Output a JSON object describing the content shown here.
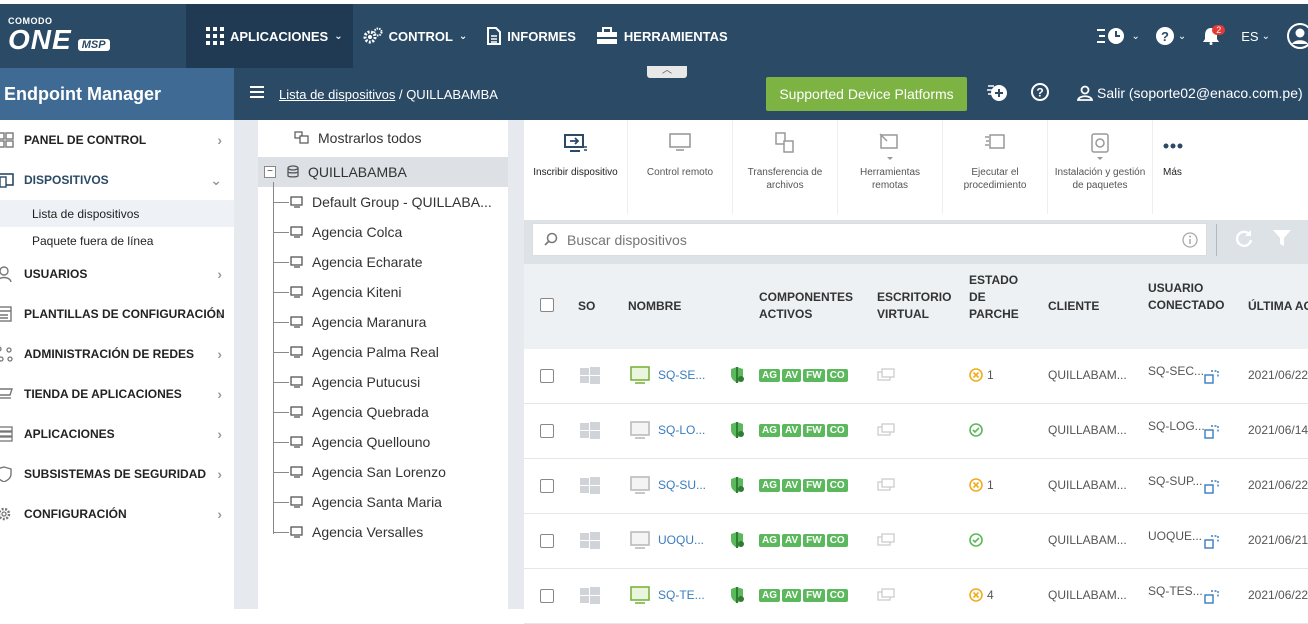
{
  "brand": {
    "company": "COMODO",
    "product": "ONE",
    "edition": "MSP"
  },
  "topnav": {
    "menus": [
      {
        "label": "APLICACIONES",
        "active": true,
        "dropdown": true,
        "icon": "grid-icon"
      },
      {
        "label": "CONTROL",
        "active": false,
        "dropdown": true,
        "icon": "gears-icon"
      },
      {
        "label": "INFORMES",
        "active": false,
        "dropdown": false,
        "icon": "report-icon"
      },
      {
        "label": "HERRAMIENTAS",
        "active": false,
        "dropdown": false,
        "icon": "toolbox-icon"
      }
    ],
    "notifications_count": "2",
    "language": "ES"
  },
  "module_title": "Endpoint Manager",
  "breadcrumb": {
    "link": "Lista de dispositivos",
    "separator": " / ",
    "current": "QUILLABAMBA"
  },
  "supported_button": "Supported Device Platforms",
  "logout": "Salir (soporte02@enaco.com.pe)",
  "sidebar": {
    "items": [
      {
        "label": "PANEL DE CONTROL",
        "icon": "dashboard-icon"
      },
      {
        "label": "DISPOSITIVOS",
        "icon": "devices-icon",
        "expanded": true
      },
      {
        "label": "USUARIOS",
        "icon": "user-icon"
      },
      {
        "label": "PLANTILLAS DE CONFIGURACIÓN",
        "icon": "template-icon"
      },
      {
        "label": "ADMINISTRACIÓN DE REDES",
        "icon": "network-icon"
      },
      {
        "label": "TIENDA DE APLICACIONES",
        "icon": "store-icon"
      },
      {
        "label": "APLICACIONES",
        "icon": "apps-icon"
      },
      {
        "label": "SUBSISTEMAS DE SEGURIDAD",
        "icon": "shield-icon"
      },
      {
        "label": "CONFIGURACIÓN",
        "icon": "gear-icon"
      }
    ],
    "sub_items": [
      "Lista de dispositivos",
      "Paquete fuera de línea"
    ]
  },
  "tree": {
    "show_all": "Mostrarlos todos",
    "root": "QUILLABAMBA",
    "children": [
      "Default Group - QUILLABA...",
      "Agencia Colca",
      "Agencia Echarate",
      "Agencia Kiteni",
      "Agencia Maranura",
      "Agencia Palma Real",
      "Agencia Putucusi",
      "Agencia Quebrada",
      "Agencia Quellouno",
      "Agencia San Lorenzo",
      "Agencia Santa Maria",
      "Agencia Versalles"
    ]
  },
  "toolbar": [
    {
      "label": "Inscribir dispositivo",
      "icon": "enroll-icon",
      "enabled": true
    },
    {
      "label": "Control remoto",
      "icon": "monitor-icon",
      "enabled": false
    },
    {
      "label": "Transferencia de archivos",
      "icon": "file-transfer-icon",
      "enabled": false
    },
    {
      "label": "Herramientas remotas",
      "icon": "remote-tools-icon",
      "enabled": false
    },
    {
      "label": "Ejecutar el procedimiento",
      "icon": "run-procedure-icon",
      "enabled": false
    },
    {
      "label": "Instalación y gestión de paquetes",
      "icon": "package-icon",
      "enabled": false
    },
    {
      "label": "Más",
      "icon": "more-icon",
      "enabled": true
    }
  ],
  "search": {
    "placeholder": "Buscar dispositivos"
  },
  "table": {
    "headers": [
      "SO",
      "NOMBRE",
      "COMPONENTES ACTIVOS",
      "ESCRITORIO VIRTUAL",
      "ESTADO DE PARCHE",
      "CLIENTE",
      "USUARIO CONECTADO",
      "ÚLTIMA AC"
    ],
    "components": [
      "AG",
      "AV",
      "FW",
      "CO"
    ],
    "rows": [
      {
        "name": "SQ-SE...",
        "online": true,
        "patch": "1",
        "patch_state": "warning",
        "client": "QUILLABAM...",
        "user": "SQ-SEC...",
        "last": "2021/06/22"
      },
      {
        "name": "SQ-LO...",
        "online": false,
        "patch": "",
        "patch_state": "ok",
        "client": "QUILLABAM...",
        "user": "SQ-LOG...",
        "last": "2021/06/14"
      },
      {
        "name": "SQ-SU...",
        "online": false,
        "patch": "1",
        "patch_state": "warning",
        "client": "QUILLABAM...",
        "user": "SQ-SUP...",
        "last": "2021/06/22"
      },
      {
        "name": "UOQU...",
        "online": false,
        "patch": "",
        "patch_state": "ok",
        "client": "QUILLABAM...",
        "user": "UOQUE...",
        "last": "2021/06/21"
      },
      {
        "name": "SQ-TE...",
        "online": true,
        "patch": "4",
        "patch_state": "warning",
        "client": "QUILLABAM...",
        "user": "SQ-TES...",
        "last": "2021/06/22"
      }
    ]
  },
  "colors": {
    "nav": "#2b4a66",
    "module": "#3f6a93",
    "accent_green": "#7cb342",
    "chip_green": "#5cb85c",
    "link": "#3a7cbd"
  }
}
